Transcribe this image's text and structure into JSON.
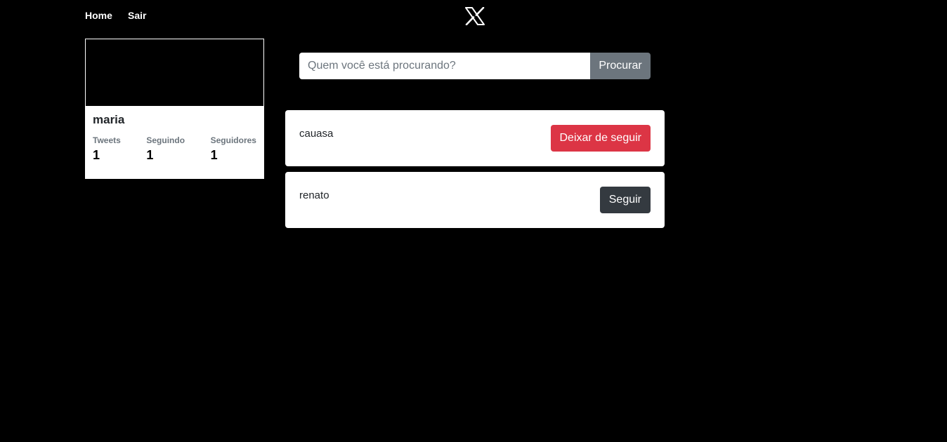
{
  "nav": {
    "home_label": "Home",
    "logout_label": "Sair",
    "logo_icon": "x-logo-icon"
  },
  "profile": {
    "username": "maria",
    "stats": [
      {
        "label": "Tweets",
        "value": "1"
      },
      {
        "label": "Seguindo",
        "value": "1"
      },
      {
        "label": "Seguidores",
        "value": "1"
      }
    ]
  },
  "search": {
    "placeholder": "Quem você está procurando?",
    "value": "",
    "button_label": "Procurar"
  },
  "users": [
    {
      "name": "cauasa",
      "action_label": "Deixar de seguir",
      "following": true
    },
    {
      "name": "renato",
      "action_label": "Seguir",
      "following": false
    }
  ],
  "colors": {
    "background": "#000000",
    "unfollow": "#dc3545",
    "follow": "#343a40",
    "search_button": "#6c757d"
  }
}
